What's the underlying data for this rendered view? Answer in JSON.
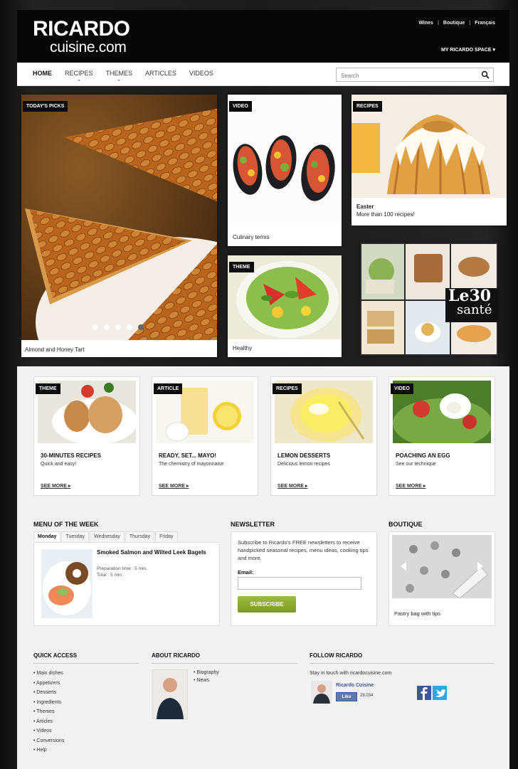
{
  "header": {
    "logo_top": "RICARDO",
    "logo_bottom": "cuisine.com",
    "toplinks": [
      "Wines",
      "Boutique",
      "Français"
    ],
    "myspace": "MY RICARDO SPACE ▾"
  },
  "nav": {
    "items": [
      "HOME",
      "RECIPES",
      "THEMES",
      "ARTICLES",
      "VIDEOS"
    ],
    "search_placeholder": "Search"
  },
  "hero": {
    "main": {
      "tag": "TODAY'S PICKS",
      "caption": "Almond and Honey Tart"
    },
    "video": {
      "tag": "VIDEO",
      "caption": "Culinary terms"
    },
    "theme": {
      "tag": "THEME",
      "caption": "Healthy"
    },
    "recipes": {
      "tag": "RECIPES",
      "title": "Easter",
      "caption": "More than 100 recipes!"
    },
    "promo": {
      "line1": "Le30",
      "line2": "santé"
    }
  },
  "features": [
    {
      "tag": "THEME",
      "title": "30-MINUTES RECIPES",
      "sub": "Quick and easy!",
      "more": "SEE MORE ▸"
    },
    {
      "tag": "ARTICLE",
      "title": "READY, SET... MAYO!",
      "sub": "The chemistry of mayonnaise",
      "more": "SEE MORE ▸"
    },
    {
      "tag": "RECIPES",
      "title": "LEMON DESSERTS",
      "sub": "Delicious lemon recipes",
      "more": "SEE MORE ▸"
    },
    {
      "tag": "VIDEO",
      "title": "POACHING AN EGG",
      "sub": "See our technique",
      "more": "SEE MORE ▸"
    }
  ],
  "menu_week": {
    "heading": "MENU OF THE WEEK",
    "days": [
      "Monday",
      "Tuesday",
      "Wednesday",
      "Thursday",
      "Friday"
    ],
    "recipe_title": "Smoked Salmon and Wilted Leek Bagels",
    "prep": "Preparation time : 5 min.",
    "total": "Total : 5 min."
  },
  "newsletter": {
    "heading": "NEWSLETTER",
    "text": "Subscribe to Ricardo's FREE newsletters to receive handpicked seasonal recipes, menu ideas, cooking tips and more.",
    "email_label": "Email:",
    "button": "SUBSCRIBE"
  },
  "boutique": {
    "heading": "BOUTIQUE",
    "caption": "Pastry bag with tips"
  },
  "footer": {
    "quick_heading": "QUICK ACCESS",
    "quick_links": [
      "Main dishes",
      "Appetizers",
      "Desserts",
      "Ingredients",
      "Themes",
      "Articles",
      "Videos",
      "Conversions",
      "Help"
    ],
    "about_heading": "ABOUT RICARDO",
    "about_links": [
      "Biography",
      "News"
    ],
    "follow_heading": "FOLLOW RICARDO",
    "follow_text": "Stay in touch with ricardocuisine.com",
    "fb_name": "Ricardo Cuisine",
    "like_label": "Like",
    "like_count": "29,034"
  },
  "colors": {
    "accent_green": "#8aab2f",
    "facebook": "#3b5998",
    "twitter": "#2fa7de"
  }
}
